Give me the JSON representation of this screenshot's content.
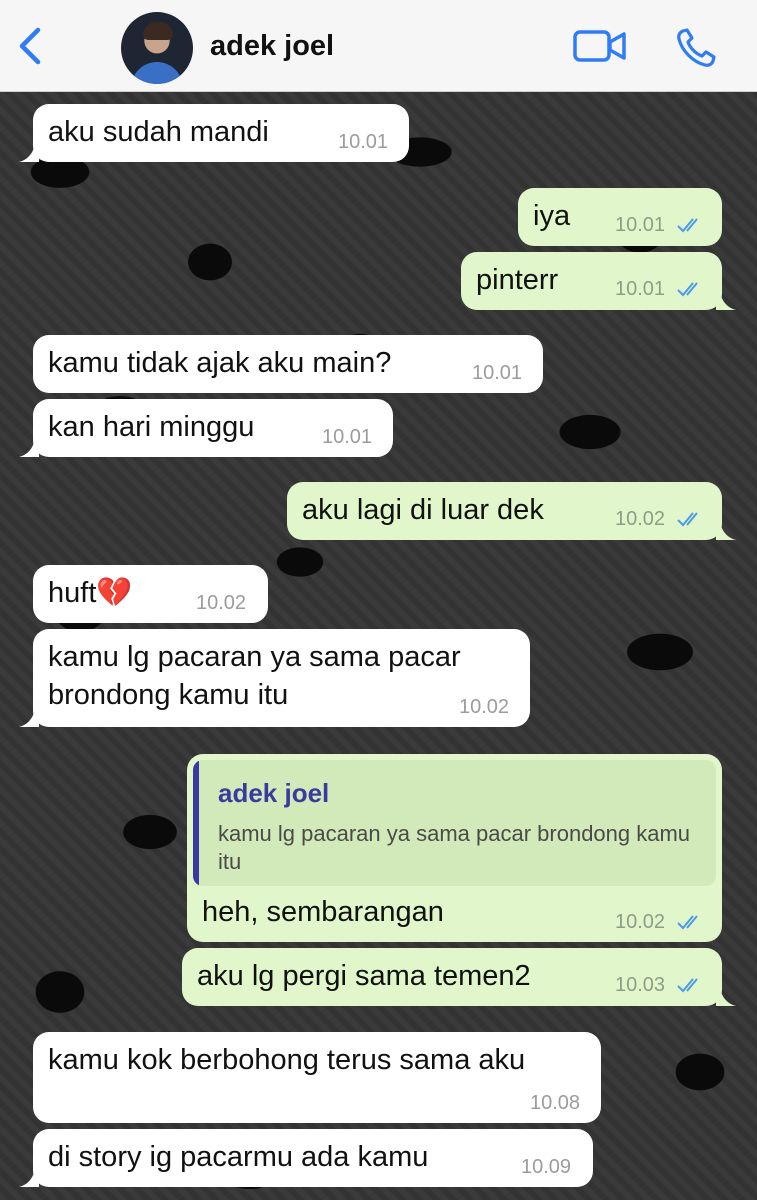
{
  "header": {
    "contact_name": "adek joel",
    "back_icon": "chevron-left-icon",
    "video_icon": "video-call-icon",
    "phone_icon": "phone-icon",
    "accent_color": "#2f7cf6"
  },
  "messages": [
    {
      "direction": "in",
      "text": "aku sudah mandi",
      "time": "10.01"
    },
    {
      "direction": "out",
      "text": "iya",
      "time": "10.01"
    },
    {
      "direction": "out",
      "text": "pinterr",
      "time": "10.01"
    },
    {
      "direction": "in",
      "text": "kamu tidak ajak aku main?",
      "time": "10.01"
    },
    {
      "direction": "in",
      "text": "kan hari minggu",
      "time": "10.01"
    },
    {
      "direction": "out",
      "text": "aku lagi di luar dek",
      "time": "10.02"
    },
    {
      "direction": "in",
      "text": "huft💔",
      "time": "10.02"
    },
    {
      "direction": "in",
      "text_line1": "kamu lg pacaran ya sama pacar",
      "text_line2": "brondong kamu itu",
      "time": "10.02"
    },
    {
      "direction": "out",
      "reply_to_name": "adek joel",
      "reply_to_text": "kamu lg pacaran ya sama pacar brondong kamu itu",
      "text": "heh, sembarangan",
      "time": "10.02"
    },
    {
      "direction": "out",
      "text": "aku lg pergi sama temen2",
      "time": "10.03"
    },
    {
      "direction": "in",
      "text": "kamu kok berbohong terus sama aku",
      "time": "10.08"
    },
    {
      "direction": "in",
      "text": "di story ig pacarmu ada kamu",
      "time": "10.09"
    }
  ],
  "colors": {
    "incoming_bubble": "#ffffff",
    "outgoing_bubble": "#e1f7cb",
    "read_ticks": "#4a9be8",
    "quote_accent": "#3b3aa0"
  }
}
